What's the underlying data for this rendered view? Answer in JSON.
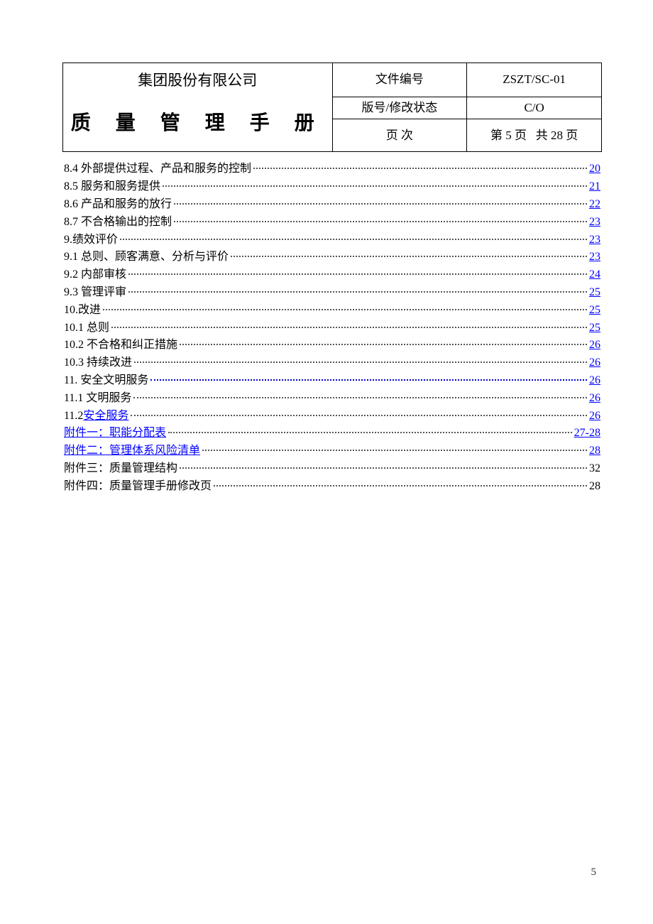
{
  "header": {
    "company_name": "集团股份有限公司",
    "doc_title": "质 量 管 理 手 册",
    "doc_number_label": "文件编号",
    "doc_number_value": "ZSZT/SC-01",
    "version_label": "版号/修改状态",
    "version_value": "C/O",
    "page_label": "页     次",
    "page_value_current": "第 5 页",
    "page_value_total": "共 28 页"
  },
  "toc": [
    {
      "text": "8.4 外部提供过程、产品和服务的控制 ",
      "page": "20",
      "text_link": false,
      "page_link": true
    },
    {
      "text": "8.5 服务和服务提供 ",
      "page": "21",
      "text_link": false,
      "page_link": true
    },
    {
      "text": "8.6 产品和服务的放行 ",
      "page": "22",
      "text_link": false,
      "page_link": true
    },
    {
      "text": "8.7 不合格输出的控制 ",
      "page": "23",
      "text_link": false,
      "page_link": true
    },
    {
      "text": "9.绩效评价",
      "page": "23",
      "text_link": false,
      "page_link": true
    },
    {
      "text": "9.1 总则、顾客满意、分析与评价 ",
      "page": "23",
      "text_link": false,
      "page_link": true
    },
    {
      "text": "9.2 内部审核 ",
      "page": "24",
      "text_link": false,
      "page_link": true
    },
    {
      "text": "9.3 管理评审 ",
      "page": "25",
      "text_link": false,
      "page_link": true
    },
    {
      "text": "10.改进 ",
      "page": "25",
      "text_link": false,
      "page_link": true
    },
    {
      "text": "10.1 总则",
      "page": "25",
      "text_link": false,
      "page_link": true
    },
    {
      "text": "10.2 不合格和纠正措施 ",
      "page": "26",
      "text_link": false,
      "page_link": true
    },
    {
      "text": "10.3 持续改进 ",
      "page": "26",
      "text_link": false,
      "page_link": true
    },
    {
      "text": "11. 安全文明服务",
      "page": "26",
      "text_link": false,
      "page_link": true,
      "dots_link": true
    },
    {
      "text": "11.1 文明服务",
      "page": "26",
      "text_link": false,
      "page_link": true
    },
    {
      "prefix": "11.2 ",
      "link_text": "安全服务",
      "page": "26",
      "text_link": true,
      "page_link": true
    },
    {
      "link_text": "附件一：职能分配表",
      "page": "27-28",
      "text_link": true,
      "page_link": true
    },
    {
      "link_text": "附件二：管理体系风险清单",
      "page": "28",
      "text_link": true,
      "page_link": true
    },
    {
      "text": "附件三：质量管理结构 ",
      "page": "32",
      "text_link": false,
      "page_link": false
    },
    {
      "text": "附件四：质量管理手册修改页 ",
      "page": "28",
      "text_link": false,
      "page_link": false
    }
  ],
  "footer": {
    "page_number": "5"
  }
}
